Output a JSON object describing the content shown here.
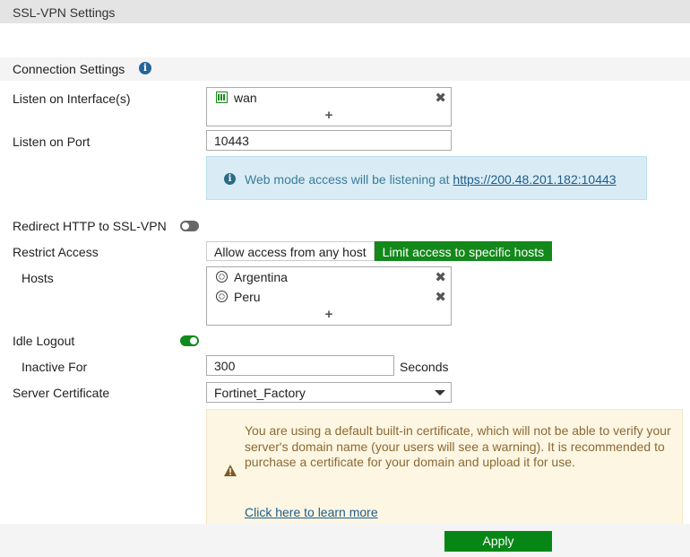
{
  "window": {
    "title": "SSL-VPN Settings"
  },
  "section": {
    "title": "Connection Settings",
    "info_icon": "info-circle-icon"
  },
  "listen_interfaces": {
    "label": "Listen on Interface(s)",
    "items": [
      {
        "name": "wan",
        "icon": "network-port-icon"
      }
    ],
    "add_label": "+",
    "remove_label": "✖"
  },
  "listen_port": {
    "label": "Listen on Port",
    "value": "10443"
  },
  "web_mode_info": {
    "icon": "info-circle-icon",
    "text": "Web mode access will be listening at ",
    "link": "https://200.48.201.182:10443"
  },
  "redirect_http": {
    "label": "Redirect HTTP to SSL-VPN",
    "enabled": false
  },
  "restrict_access": {
    "label": "Restrict Access",
    "options": [
      "Allow access from any host",
      "Limit access to specific hosts"
    ],
    "selected": "Limit access to specific hosts"
  },
  "hosts": {
    "label": "Hosts",
    "items": [
      {
        "name": "Argentina",
        "icon": "globe-icon"
      },
      {
        "name": "Peru",
        "icon": "globe-icon"
      }
    ],
    "add_label": "+",
    "remove_label": "✖"
  },
  "idle_logout": {
    "label": "Idle Logout",
    "enabled": true
  },
  "inactive_for": {
    "label": "Inactive For",
    "value": "300",
    "unit": "Seconds"
  },
  "server_certificate": {
    "label": "Server Certificate",
    "selected": "Fortinet_Factory"
  },
  "cert_warning": {
    "icon": "warning-triangle-icon",
    "text": "You are using a default built-in certificate, which will not be able to verify your server's domain name (your users will see a warning). It is recommended to purchase a certificate for your domain and upload it for use.",
    "link": "Click here to learn more"
  },
  "footer": {
    "apply_label": "Apply"
  },
  "colors": {
    "accent_green": "#13881b",
    "info_blue": "#24669c",
    "warning_brown": "#8b6a33"
  }
}
